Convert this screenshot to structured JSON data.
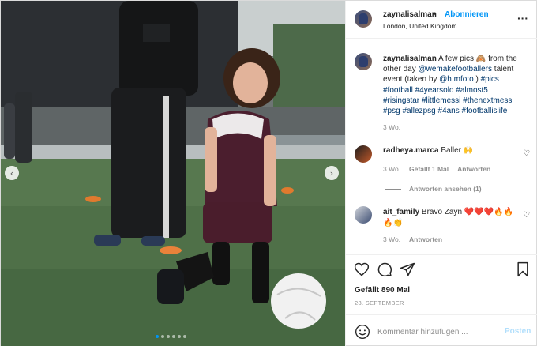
{
  "header": {
    "username": "zaynalisalman",
    "separator": "•",
    "follow_label": "Abonnieren",
    "location": "London, United Kingdom",
    "more_icon": "ellipsis-icon"
  },
  "photo": {
    "carousel_dots": 6,
    "active_dot": 0,
    "prev_icon": "chevron-left-icon",
    "next_icon": "chevron-right-icon"
  },
  "caption": {
    "username": "zaynalisalman",
    "text_1": " A few pics ",
    "emoji": "🙈",
    "text_2": " from the other day ",
    "mention_1": "@wemakefootballers",
    "text_3": " talent event (taken by ",
    "mention_2": "@h.mfoto",
    "text_4": " )",
    "hashtags": "#pics #football #4yearsold #almost5 #risingstar #littlemessi #thenextmessi #psg #allezpsg #4ans #footballislife",
    "age": "3 Wo."
  },
  "comments": [
    {
      "username": "radheya.marca",
      "text": " Baller 🙌",
      "age": "3 Wo.",
      "likes": "Gefällt 1 Mal",
      "reply": "Antworten",
      "view_replies": "Antworten ansehen (1)"
    },
    {
      "username": "ait_family",
      "text": " Bravo Zayn ❤️❤️❤️🔥🔥🔥👏",
      "age": "3 Wo.",
      "reply": "Antworten"
    }
  ],
  "actions": {
    "like_icon": "heart-icon",
    "comment_icon": "comment-icon",
    "share_icon": "paper-plane-icon",
    "save_icon": "bookmark-icon"
  },
  "likes": "Gefällt 890 Mal",
  "date": "28. SEPTEMBER",
  "add_comment": {
    "placeholder": "Kommentar hinzufügen ...",
    "post_label": "Posten",
    "emoji_icon": "smiley-icon"
  },
  "colors": {
    "accent": "#0095f6",
    "link": "#00376b",
    "muted": "#8e8e8e",
    "post_disabled": "#b2dffc"
  }
}
